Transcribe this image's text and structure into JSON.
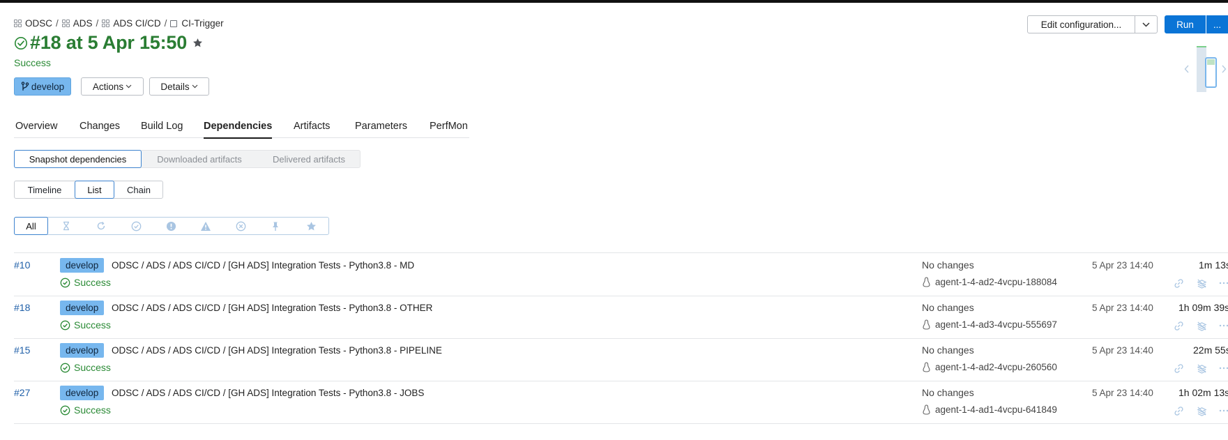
{
  "breadcrumb": [
    {
      "label": "ODSC",
      "icon": "project-grid-icon"
    },
    {
      "label": "ADS",
      "icon": "project-grid-icon"
    },
    {
      "label": "ADS CI/CD",
      "icon": "project-grid-icon"
    },
    {
      "label": "CI-Trigger",
      "icon": "build-config-icon"
    }
  ],
  "breadcrumb_sep": "/",
  "build": {
    "title": "#18 at 5 Apr 15:50",
    "status": "Success",
    "branch": "develop"
  },
  "actions": {
    "actions_label": "Actions",
    "details_label": "Details"
  },
  "toolbar": {
    "edit_label": "Edit configuration...",
    "run_label": "Run",
    "more_label": "..."
  },
  "tabs": [
    "Overview",
    "Changes",
    "Build Log",
    "Dependencies",
    "Artifacts",
    "Parameters",
    "PerfMon"
  ],
  "active_tab": "Dependencies",
  "dep_tabs": [
    "Snapshot dependencies",
    "Downloaded artifacts",
    "Delivered artifacts"
  ],
  "view_tabs": [
    "Timeline",
    "List",
    "Chain"
  ],
  "filters": {
    "all_label": "All",
    "icons": [
      "hourglass-icon",
      "refresh-icon",
      "check-circle-icon",
      "exclamation-circle-icon",
      "warning-triangle-icon",
      "cancel-circle-icon",
      "pin-icon",
      "star-icon"
    ]
  },
  "builds": [
    {
      "number": "#10",
      "branch": "develop",
      "name": "ODSC / ADS / ADS CI/CD / [GH ADS] Integration Tests - Python3.8 - MD",
      "status": "Success",
      "changes": "No changes",
      "agent": "agent-1-4-ad2-4vcpu-188084",
      "date": "5 Apr 23 14:40",
      "duration": "1m 13s"
    },
    {
      "number": "#18",
      "branch": "develop",
      "name": "ODSC / ADS / ADS CI/CD / [GH ADS] Integration Tests - Python3.8 - OTHER",
      "status": "Success",
      "changes": "No changes",
      "agent": "agent-1-4-ad3-4vcpu-555697",
      "date": "5 Apr 23 14:40",
      "duration": "1h 09m 39s"
    },
    {
      "number": "#15",
      "branch": "develop",
      "name": "ODSC / ADS / ADS CI/CD / [GH ADS] Integration Tests - Python3.8 - PIPELINE",
      "status": "Success",
      "changes": "No changes",
      "agent": "agent-1-4-ad2-4vcpu-260560",
      "date": "5 Apr 23 14:40",
      "duration": "22m 55s"
    },
    {
      "number": "#27",
      "branch": "develop",
      "name": "ODSC / ADS / ADS CI/CD / [GH ADS] Integration Tests - Python3.8 - JOBS",
      "status": "Success",
      "changes": "No changes",
      "agent": "agent-1-4-ad1-4vcpu-641849",
      "date": "5 Apr 23 14:40",
      "duration": "1h 02m 13s"
    }
  ],
  "colors": {
    "success": "#2a8a35",
    "accent": "#0a74d6",
    "branch_badge": "#77b7ee",
    "link": "#1f5fa8"
  }
}
